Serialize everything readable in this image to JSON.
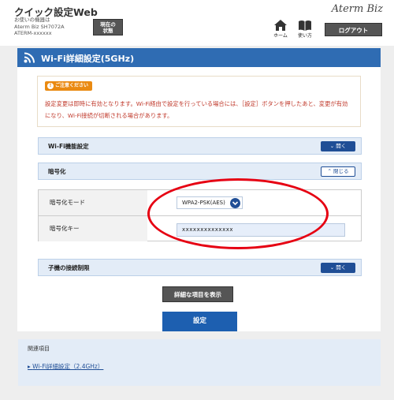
{
  "header": {
    "app_title": "クイック設定Web",
    "device_label": "お使いの機器は",
    "device_model": "Aterm Biz SH7072A",
    "device_id": "ATERM-xxxxxx",
    "status_button_line1": "現在の",
    "status_button_line2": "状態",
    "brand": "Aterm Biz",
    "home_label": "ホーム",
    "help_label": "使い方",
    "logout_label": "ログアウト"
  },
  "page": {
    "title": "Wi-Fi詳細設定(5GHz)"
  },
  "notice": {
    "badge": "ご注意ください",
    "text": "設定変更は即時に有効となります。Wi-Fi経由で設定を行っている場合には、［設定］ボタンを押したあと、変更が有効になり、Wi-Fi接続が切断される場合があります。"
  },
  "sections": {
    "wifi_function": {
      "title": "Wi-Fi機能設定",
      "toggle": "開く"
    },
    "encryption": {
      "title": "暗号化",
      "toggle": "閉じる"
    },
    "client_restriction": {
      "title": "子機の接続制限",
      "toggle": "開く"
    }
  },
  "encryption": {
    "mode_label": "暗号化モード",
    "mode_value": "WPA2-PSK(AES)",
    "key_label": "暗号化キー",
    "key_value": "xxxxxxxxxxxxxx"
  },
  "buttons": {
    "show_details": "詳細な項目を表示",
    "apply": "設定"
  },
  "related": {
    "title": "関連項目",
    "link": "Wi-Fi詳細設定（2.4GHz）"
  },
  "colors": {
    "accent_blue": "#2f6cb3",
    "annotation_red": "#e60012",
    "notice_orange": "#ea8a12"
  }
}
